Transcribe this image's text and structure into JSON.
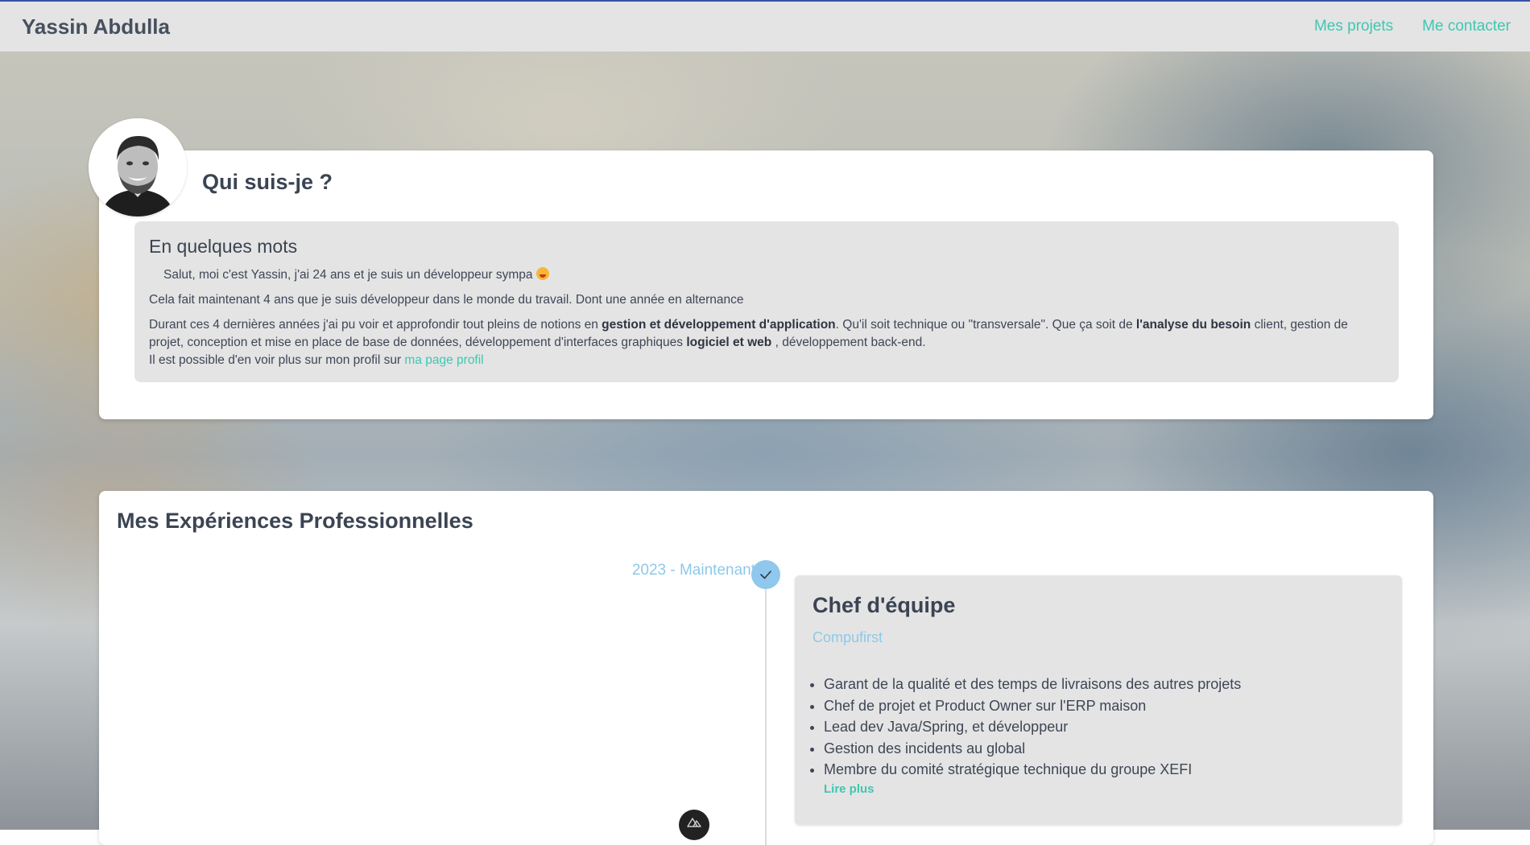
{
  "navbar": {
    "brand": "Yassin Abdulla",
    "links": [
      "Mes projets",
      "Me contacter"
    ]
  },
  "about": {
    "title": "Qui suis-je ?",
    "subtitle": "En quelques mots",
    "intro": "Salut, moi c'est Yassin, j'ai 24 ans et je suis un développeur sympa",
    "p2": "Cela fait maintenant 4 ans que je suis développeur dans le monde du travail. Dont une année en alternance",
    "p3_a": "Durant ces 4 dernières années j'ai pu voir et approfondir tout pleins de notions en ",
    "p3_b": "gestion et développement d'application",
    "p3_c": ". Qu'il soit technique ou \"transversale\". Que ça soit de ",
    "p3_d": "l'analyse du besoin",
    "p3_e": " client, gestion de projet, conception et mise en place de base de données, développement d'interfaces graphiques ",
    "p3_f": "logiciel et web",
    "p3_g": " , développement back-end.",
    "p4_a": "Il est possible d'en voir plus sur mon profil sur ",
    "p4_link": "ma page profil"
  },
  "experience": {
    "title": "Mes Expériences Professionnelles",
    "items": [
      {
        "date": "2023 - Maintenant",
        "role": "Chef d'équipe",
        "company": "Compufirst",
        "bullets": [
          "Garant de la qualité et des temps de livraisons des autres projets",
          "Chef de projet et Product Owner sur l'ERP maison",
          "Lead dev Java/Spring, et développeur",
          "Gestion des incidents au global",
          "Membre du comité stratégique technique du groupe XEFI"
        ],
        "read_more": "Lire plus"
      }
    ]
  },
  "colors": {
    "accent": "#3ec7b2",
    "timeline": "#8fc8ec",
    "nav_bg": "#e4e4e4",
    "nav_border": "#3552a6"
  },
  "icons": [
    "check-icon",
    "avatar-portrait",
    "nuxt-logo-icon"
  ]
}
